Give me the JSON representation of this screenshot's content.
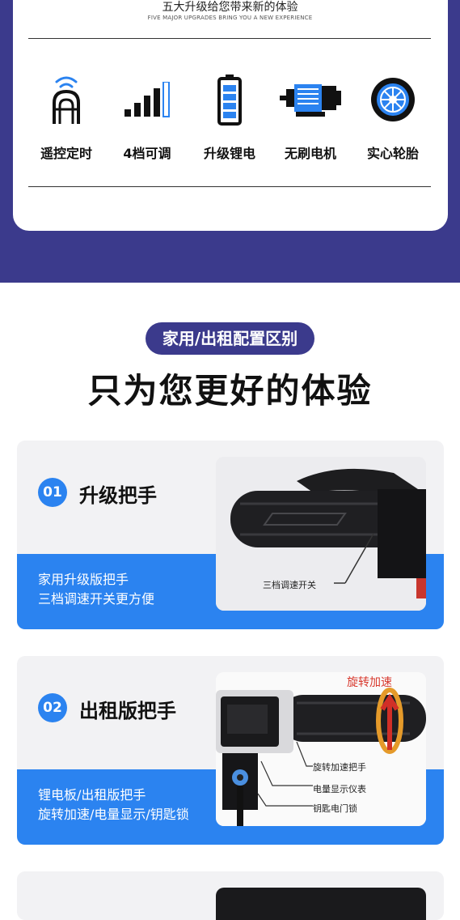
{
  "header": {
    "title": "五大升级给您带来新的体验",
    "subtitle": "FIVE MAJOR UPGRADES BRING YOU A NEW EXPERIENCE"
  },
  "features": [
    {
      "icon": "remote-key-icon",
      "label": "遥控定时"
    },
    {
      "icon": "signal-bars-icon",
      "label": "4档可调"
    },
    {
      "icon": "battery-icon",
      "label": "升级锂电"
    },
    {
      "icon": "motor-icon",
      "label": "无刷电机"
    },
    {
      "icon": "tire-icon",
      "label": "实心轮胎"
    }
  ],
  "section": {
    "pill": "家用/出租配置区别",
    "title": "只为您更好的体验"
  },
  "cards": [
    {
      "num": "01",
      "title": "升级把手",
      "desc_line1": "家用升级版把手",
      "desc_line2": "三档调速开关更方便",
      "callout": "三档调速开关"
    },
    {
      "num": "02",
      "title": "出租版把手",
      "desc_line1": "锂电板/出租版把手",
      "desc_line2": "旋转加速/电量显示/钥匙锁",
      "photo_label": "旋转加速",
      "callouts": [
        "旋转加速把手",
        "电量显示仪表",
        "钥匙电门锁"
      ]
    }
  ],
  "colors": {
    "navy": "#3b3a8c",
    "accent_blue": "#2b83f0"
  }
}
